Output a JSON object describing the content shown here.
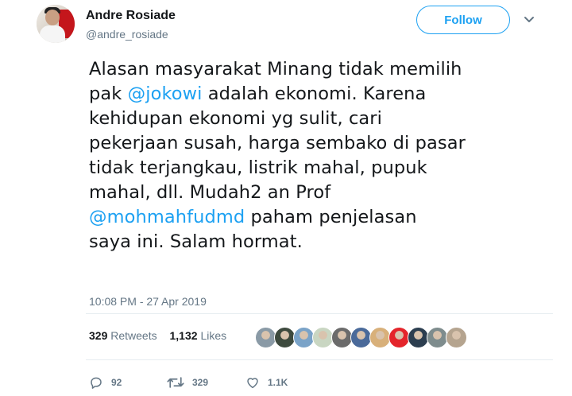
{
  "user": {
    "display_name": "Andre Rosiade",
    "handle": "@andre_rosiade",
    "follow_label": "Follow"
  },
  "tweet": {
    "segments": [
      {
        "text": "Alasan masyarakat Minang tidak memilih",
        "type": "text"
      },
      {
        "text": "pak ",
        "type": "text"
      },
      {
        "text": "@jokowi",
        "type": "mention"
      },
      {
        "text": " adalah ekonomi. Karena",
        "type": "text"
      },
      {
        "text": "kehidupan ekonomi yg sulit, cari",
        "type": "text"
      },
      {
        "text": "pekerjaan susah, harga sembako di pasar",
        "type": "text"
      },
      {
        "text": "tidak terjangkau, listrik mahal, pupuk",
        "type": "text"
      },
      {
        "text": "mahal, dll. Mudah2 an Prof",
        "type": "text"
      },
      {
        "text": "@mohmahfudmd",
        "type": "mention"
      },
      {
        "text": " paham penjelasan",
        "type": "text"
      },
      {
        "text": "saya ini. Salam hormat.",
        "type": "text"
      }
    ],
    "timestamp": "10:08 PM - 27 Apr 2019"
  },
  "stats": {
    "retweets_count": "329",
    "retweets_label": "Retweets",
    "likes_count": "1,132",
    "likes_label": "Likes"
  },
  "likers": {
    "colors": [
      "#8a9aa6",
      "#3d4a3e",
      "#7aa3c8",
      "#c9d6c2",
      "#6b6b6b",
      "#4a6a9a",
      "#d8b07a",
      "#e4252b",
      "#2c3e50",
      "#7e8c8d",
      "#b5a48f"
    ]
  },
  "actions": {
    "reply_count": "92",
    "retweet_count": "329",
    "like_count": "1.1K"
  },
  "colors": {
    "accent": "#1da1f2",
    "secondary_text": "#657786",
    "primary_text": "#14171a"
  }
}
